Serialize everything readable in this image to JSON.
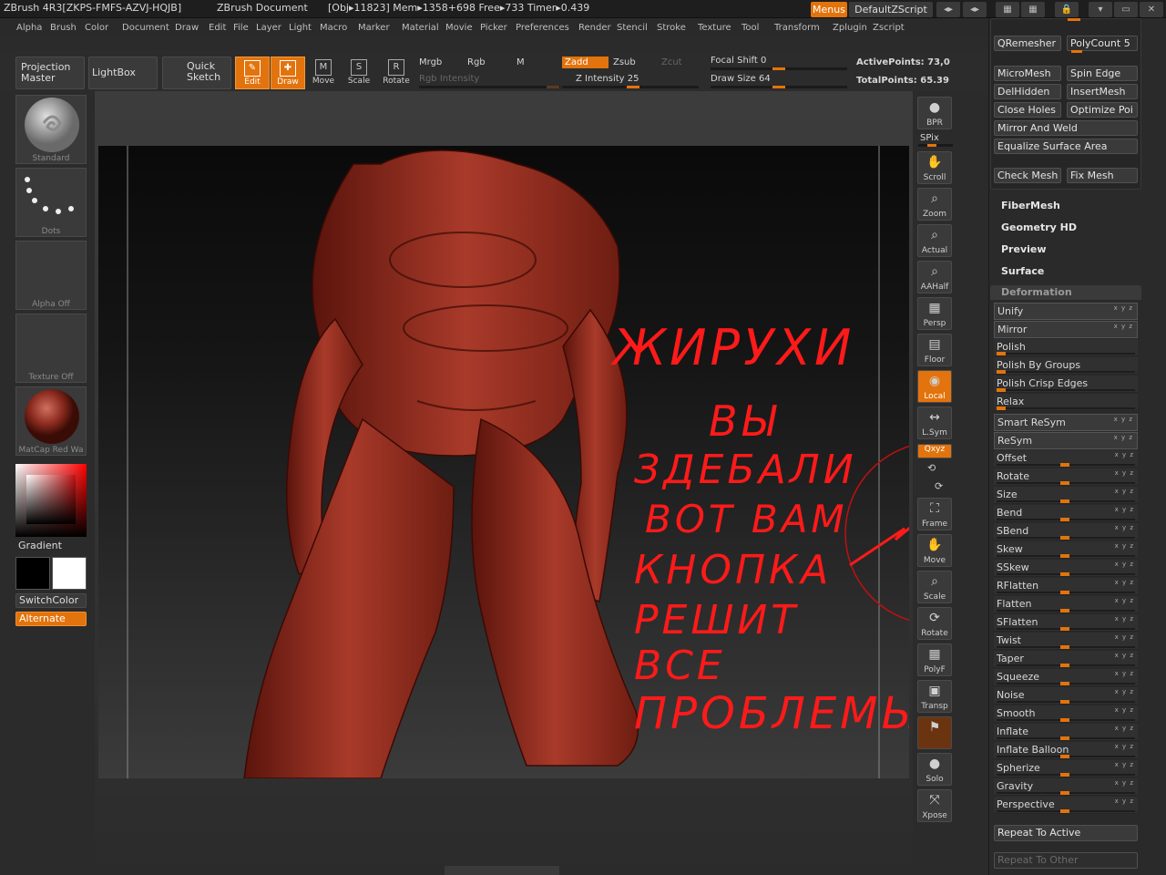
{
  "titlebar": {
    "app_title": "ZBrush 4R3[ZKPS-FMFS-AZVJ-HQJB]",
    "doc": "ZBrush Document",
    "stats": "[Obj▸11823] Mem▸1358+698 Free▸733 Timer▸0.439",
    "menus": "Menus",
    "script": "DefaultZScript"
  },
  "menubar": [
    "Alpha",
    "Brush",
    "Color",
    "Document",
    "Draw",
    "Edit",
    "File",
    "Layer",
    "Light",
    "Macro",
    "Marker",
    "Material",
    "Movie",
    "Picker",
    "Preferences",
    "Render",
    "Stencil",
    "Stroke",
    "Texture",
    "Tool",
    "Transform",
    "Zplugin",
    "Zscript"
  ],
  "toolbar": {
    "projection_master": "Projection Master",
    "lightbox": "LightBox",
    "quick_sketch": "Quick Sketch",
    "tools": [
      {
        "label": "Edit",
        "glyph": "✎"
      },
      {
        "label": "Draw",
        "glyph": "✚"
      },
      {
        "label": "Move",
        "glyph": "M"
      },
      {
        "label": "Scale",
        "glyph": "S"
      },
      {
        "label": "Rotate",
        "glyph": "R"
      }
    ],
    "mrgb": "Mrgb",
    "rgb": "Rgb",
    "m": "M",
    "zadd": "Zadd",
    "zsub": "Zsub",
    "zcut": "Zcut",
    "rgb_intensity": "Rgb Intensity",
    "z_intensity": "Z Intensity 25",
    "focal_shift": "Focal Shift 0",
    "draw_size": "Draw Size 64",
    "active_points": "ActivePoints: 73,0",
    "total_points": "TotalPoints: 65.39"
  },
  "left": {
    "brush": "Standard",
    "stroke": "Dots",
    "alpha": "Alpha Off",
    "texture": "Texture Off",
    "material": "MatCap Red Wa",
    "gradient": "Gradient",
    "switch_color": "SwitchColor",
    "alternate": "Alternate"
  },
  "right_tools": [
    {
      "label": "BPR",
      "glyph": "●"
    },
    {
      "label": "Scroll",
      "glyph": "✋"
    },
    {
      "label": "Zoom",
      "glyph": "⌕"
    },
    {
      "label": "Actual",
      "glyph": "⌕"
    },
    {
      "label": "AAHalf",
      "glyph": "⌕"
    },
    {
      "label": "Persp",
      "glyph": "▦"
    },
    {
      "label": "Floor",
      "glyph": "▤"
    },
    {
      "label": "Local",
      "glyph": "◉"
    },
    {
      "label": "L.Sym",
      "glyph": "↔"
    },
    {
      "label": "Frame",
      "glyph": "⛶"
    },
    {
      "label": "Move",
      "glyph": "✋"
    },
    {
      "label": "Scale",
      "glyph": "⌕"
    },
    {
      "label": "Rotate",
      "glyph": "⟳"
    },
    {
      "label": "PolyF",
      "glyph": "▦"
    },
    {
      "label": "Transp",
      "glyph": "▣"
    },
    {
      "label": "Solo",
      "glyph": "●"
    },
    {
      "label": "Xpose",
      "glyph": "⤧"
    }
  ],
  "spix": "SPix",
  "xyz": "Qxyz",
  "topo": {
    "qremesher": "QRemesher",
    "polycount": "PolyCount 5",
    "micromesh": "MicroMesh",
    "spin_edge": "Spin Edge",
    "delhidden": "DelHidden",
    "insertmesh": "InsertMesh",
    "close_holes": "Close Holes",
    "optimize": "Optimize Poi",
    "mirror_weld": "Mirror And Weld",
    "equalize": "Equalize Surface Area",
    "check_mesh": "Check Mesh",
    "fix_mesh": "Fix Mesh"
  },
  "subpanels": [
    "FiberMesh",
    "Geometry HD",
    "Preview",
    "Surface"
  ],
  "deformation": {
    "title": "Deformation",
    "rows": [
      "Unify",
      "Mirror",
      "Polish",
      "Polish By Groups",
      "Polish Crisp Edges",
      "Relax",
      "Smart ReSym",
      "ReSym",
      "Offset",
      "Rotate",
      "Size",
      "Bend",
      "SBend",
      "Skew",
      "SSkew",
      "RFlatten",
      "Flatten",
      "SFlatten",
      "Twist",
      "Taper",
      "Squeeze",
      "Noise",
      "Smooth",
      "Inflate",
      "Inflate Balloon",
      "Spherize",
      "Gravity",
      "Perspective"
    ],
    "repeat_active": "Repeat To Active",
    "repeat_other": "Repeat To Other"
  },
  "annotation": [
    "ЖИРУХИ",
    "ВЫ",
    "ЗДЕБАЛИ",
    "ВОТ ВАМ",
    "КНОПКА",
    "РЕШИТ",
    "ВСЕ",
    "ПРОБЛЕМЫ"
  ],
  "colors": {
    "accent": "#e3730c",
    "annotation": "#ff1a1a",
    "model": "#8a2a1e"
  }
}
